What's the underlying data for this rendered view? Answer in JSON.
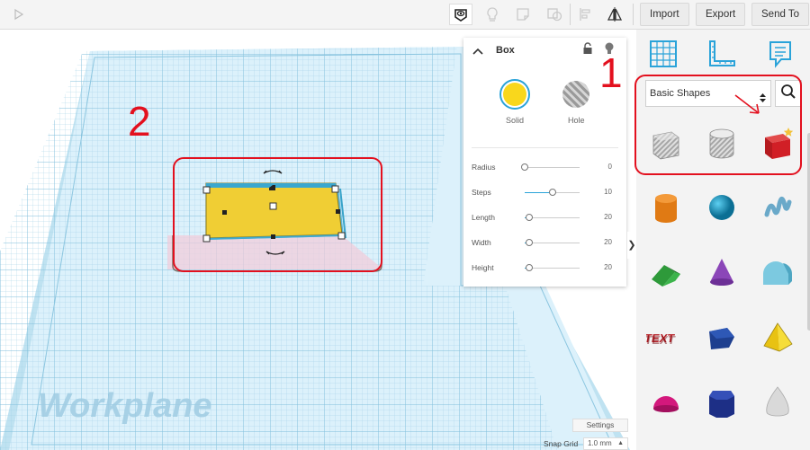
{
  "toolbar": {
    "import_label": "Import",
    "export_label": "Export",
    "send_label": "Send To"
  },
  "workplane": {
    "label": "Workplane"
  },
  "inspector": {
    "title": "Box",
    "solid_label": "Solid",
    "hole_label": "Hole",
    "solid_color": "#f9d71c",
    "properties": [
      {
        "label": "Radius",
        "value": "0",
        "fraction": 0.0
      },
      {
        "label": "Steps",
        "value": "10",
        "fraction": 0.5
      },
      {
        "label": "Length",
        "value": "20",
        "fraction": 0.08
      },
      {
        "label": "Width",
        "value": "20",
        "fraction": 0.08
      },
      {
        "label": "Height",
        "value": "20",
        "fraction": 0.08
      }
    ]
  },
  "shapes_panel": {
    "category": "Basic Shapes",
    "shapes": [
      "box-hole",
      "cylinder-hole",
      "box",
      "cylinder",
      "sphere",
      "scribble",
      "roof",
      "cone",
      "round-roof",
      "text",
      "polygon",
      "pyramid",
      "half-sphere",
      "hexagonal-prism",
      "paraboloid"
    ]
  },
  "annotations": {
    "one": "1",
    "two": "2",
    "color": "#e3101e"
  },
  "bottom": {
    "settings_label": "Settings",
    "snap_label": "Snap Grid",
    "snap_value": "1.0 mm"
  }
}
